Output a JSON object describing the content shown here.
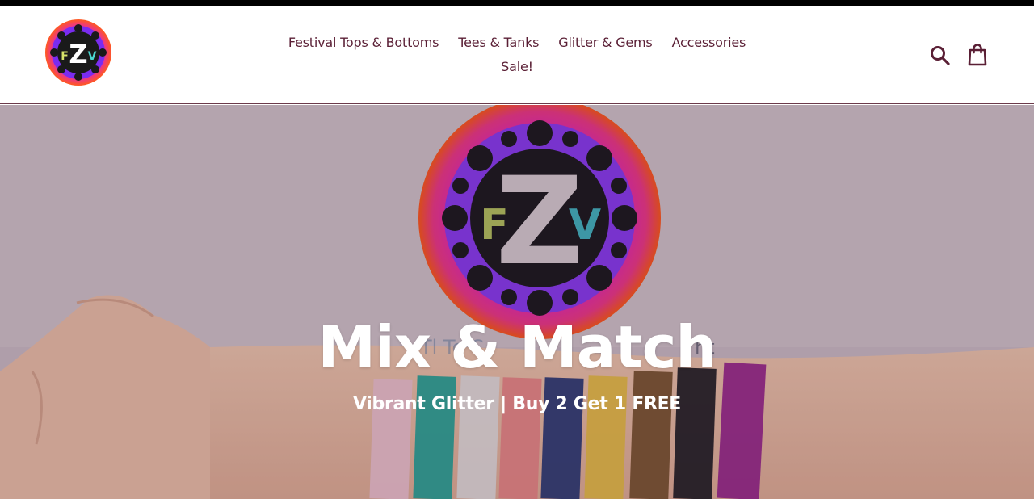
{
  "store": {
    "logo_text": "FZV",
    "logo_icon": "fzv-logo-icon"
  },
  "nav": {
    "items": [
      {
        "label": "Festival Tops & Bottoms"
      },
      {
        "label": "Tees & Tanks"
      },
      {
        "label": "Glitter & Gems"
      },
      {
        "label": "Accessories"
      },
      {
        "label": "Sale!"
      }
    ]
  },
  "header_icons": {
    "search": "search-icon",
    "cart": "shopping-bag-icon"
  },
  "hero": {
    "title": "Mix & Match",
    "subtitle": "Vibrant Glitter | Buy 2 Get 1 FREE",
    "logo_text": "FZV",
    "background_text": "Tl Te   C",
    "background_text_right": "ht"
  },
  "colors": {
    "nav_text": "#5a1f35",
    "hero_text": "#ffffff",
    "accent_pink": "#e020c8",
    "accent_purple": "#7a2cf0",
    "accent_orange": "#ff5a1e",
    "header_border": "#6b3a4a"
  }
}
